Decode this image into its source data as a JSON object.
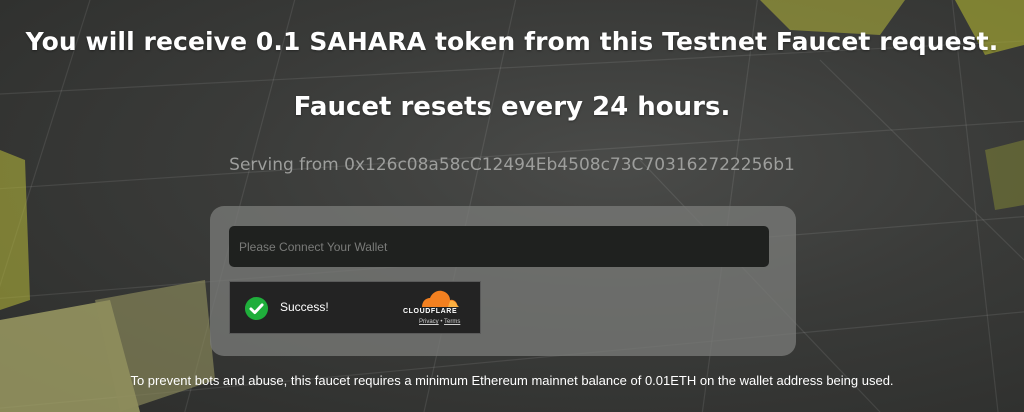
{
  "header": {
    "line1": "You will receive 0.1 SAHARA token from this Testnet Faucet request.",
    "line2": "Faucet resets every 24 hours."
  },
  "serving": {
    "text": "Serving from 0x126c08a58cC12494Eb4508c73C703162722256b1"
  },
  "form": {
    "wallet_placeholder": "Please Connect Your Wallet",
    "wallet_value": ""
  },
  "captcha": {
    "status": "Success!",
    "provider": "CLOUDFLARE",
    "privacy_label": "Privacy",
    "separator": "•",
    "terms_label": "Terms",
    "check_icon": "check-circle-icon",
    "success_color": "#1fae3b",
    "brand_color": "#f38020"
  },
  "footer": {
    "note": "To prevent bots and abuse, this faucet requires a minimum Ethereum mainnet balance of 0.01ETH on the wallet address being used."
  },
  "theme": {
    "background": "#3a3b39",
    "accent_shape": "#c8cb3a"
  }
}
